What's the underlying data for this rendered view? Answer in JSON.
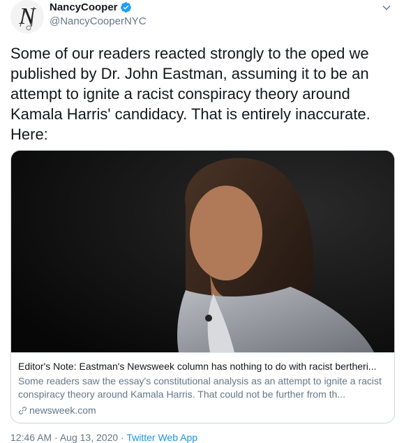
{
  "author": {
    "display_name": "NancyCooper",
    "handle": "@NancyCooperNYC",
    "avatar_letter": "N",
    "verified": true
  },
  "tweet": {
    "text": "Some of our readers reacted strongly to the oped we published by Dr. John Eastman, assuming it to be an attempt to ignite a racist conspiracy theory around Kamala Harris' candidacy. That is entirely inaccurate. Here:"
  },
  "card": {
    "title": "Editor's Note: Eastman's Newsweek column has nothing to do with racist bertheri...",
    "description": "Some readers saw the essay's constitutional analysis as an attempt to ignite a racist conspiracy theory around Kamala Harris. That could not be further from th...",
    "domain": "newsweek.com"
  },
  "meta": {
    "time": "12:46 AM",
    "separator": "·",
    "date": "Aug 13, 2020",
    "app": "Twitter Web App"
  },
  "colors": {
    "accent": "#1da1f2",
    "secondary_text": "#657786",
    "border": "#ccd6dd"
  },
  "icons": {
    "verified": "verified-badge-icon",
    "caret": "chevron-down-icon",
    "link": "link-icon"
  }
}
